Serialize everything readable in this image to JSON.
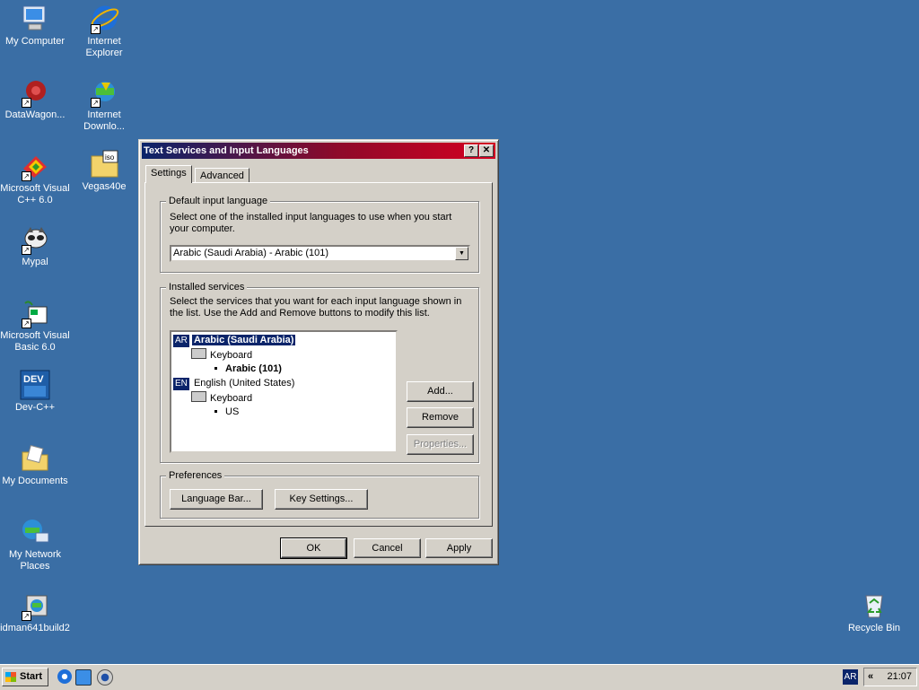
{
  "desktop": {
    "icons": [
      {
        "label": "My Computer",
        "icon": "my-computer-icon"
      },
      {
        "label": "Internet Explorer",
        "icon": "internet-explorer-icon"
      },
      {
        "label": "DataWagon...",
        "icon": "datawagon-icon"
      },
      {
        "label": "Internet Downlo...",
        "icon": "internet-download-manager-icon"
      },
      {
        "label": "Microsoft Visual C++ 6.0",
        "icon": "visual-cpp-icon"
      },
      {
        "label": "Vegas40e",
        "icon": "iso-file-icon"
      },
      {
        "label": "Mypal",
        "icon": "mypal-icon"
      },
      {
        "label": "Microsoft Visual Basic 6.0",
        "icon": "visual-basic-icon"
      },
      {
        "label": "Dev-C++",
        "icon": "dev-cpp-icon"
      },
      {
        "label": "My Documents",
        "icon": "my-documents-icon"
      },
      {
        "label": "My Network Places",
        "icon": "my-network-places-icon"
      },
      {
        "label": "idman641build2",
        "icon": "idman-installer-icon"
      },
      {
        "label": "Recycle Bin",
        "icon": "recycle-bin-icon"
      }
    ]
  },
  "dialog": {
    "title": "Text Services and Input Languages",
    "help_btn": "?",
    "close_btn": "✕",
    "tabs": [
      {
        "label": "Settings"
      },
      {
        "label": "Advanced"
      }
    ],
    "default_lang": {
      "group_label": "Default input language",
      "description": "Select one of the installed input languages to use when you start your computer.",
      "selected": "Arabic (Saudi Arabia) - Arabic (101)"
    },
    "installed": {
      "group_label": "Installed services",
      "description": "Select the services that you want for each input language shown in the list. Use the Add and Remove buttons to modify this list.",
      "tree": {
        "ar_badge": "AR",
        "ar_lang": "Arabic (Saudi Arabia)",
        "ar_kbd": "Keyboard",
        "ar_layout": "Arabic (101)",
        "en_badge": "EN",
        "en_lang": "English (United States)",
        "en_kbd": "Keyboard",
        "en_layout": "US"
      },
      "add": "Add...",
      "remove": "Remove",
      "properties": "Properties..."
    },
    "preferences": {
      "group_label": "Preferences",
      "language_bar": "Language Bar...",
      "key_settings": "Key Settings..."
    },
    "ok": "OK",
    "cancel": "Cancel",
    "apply": "Apply"
  },
  "taskbar": {
    "start": "Start",
    "lang_indicator": "AR",
    "chevron": "«",
    "clock": "21:07"
  }
}
